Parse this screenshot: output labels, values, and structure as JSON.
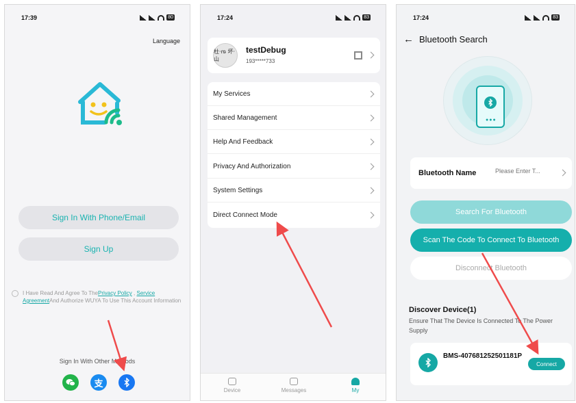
{
  "colors": {
    "accent": "#16a8a5",
    "arrow": "#ef4b4b"
  },
  "panel1": {
    "time": "17:39",
    "battery": "80",
    "language": "Language",
    "sign_in_phone": "Sign In With Phone/Email",
    "sign_up": "Sign Up",
    "agree_prefix": "I Have Read And Agree To The",
    "privacy_policy": "Privacy Policy",
    "comma": " ,",
    "service_agreement": "Service Agreement",
    "agree_suffix": "And Authorize WUYA To Use This Account Information",
    "other_methods": "Sign In With Other Methods"
  },
  "panel2": {
    "time": "17:24",
    "battery": "83",
    "user_name": "testDebug",
    "user_phone": "193*****733",
    "avatar_text": "杜·ꬺ 坏·山",
    "menu": [
      "My Services",
      "Shared Management",
      "Help And Feedback",
      "Privacy And Authorization",
      "System Settings",
      "Direct Connect Mode"
    ],
    "tabs": [
      "Device",
      "Messages",
      "My"
    ]
  },
  "panel3": {
    "time": "17:24",
    "battery": "83",
    "title": "Bluetooth Search",
    "bt_name_label": "Bluetooth Name",
    "bt_name_placeholder": "Please Enter T...",
    "search_btn": "Search For Bluetooth",
    "scan_btn": "Scan The Code To Connect To Bluetooth",
    "disconnect_btn": "Disconnect Bluetooth",
    "discover_title": "Discover Device(1)",
    "discover_sub": "Ensure That The Device Is Connected To The Power Supply",
    "device_name": "BMS-407681252501181P",
    "connect_btn": "Connect"
  }
}
